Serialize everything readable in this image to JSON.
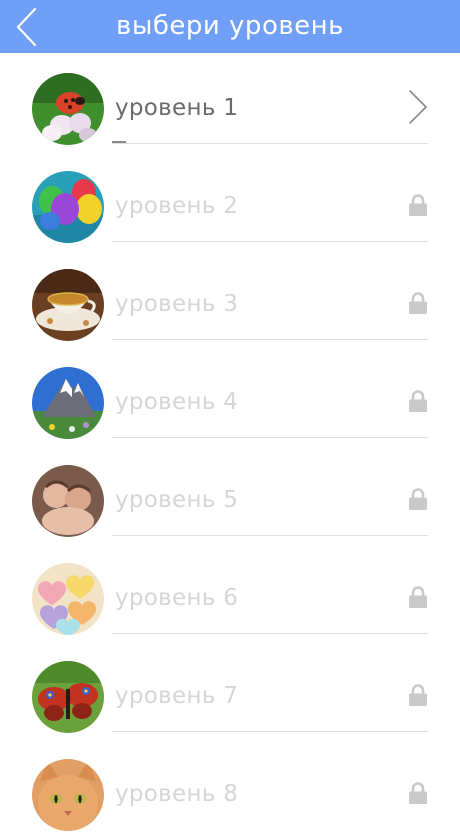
{
  "header": {
    "title": "выбери уровень",
    "background": "#6f9ff6"
  },
  "levels": [
    {
      "label": "уровень 1",
      "image": "ladybug-flower",
      "status": "unlocked"
    },
    {
      "label": "уровень 2",
      "image": "balloons",
      "status": "locked"
    },
    {
      "label": "уровень 3",
      "image": "tea-cup",
      "status": "locked"
    },
    {
      "label": "уровень 4",
      "image": "mountain",
      "status": "locked"
    },
    {
      "label": "уровень 5",
      "image": "babies",
      "status": "locked"
    },
    {
      "label": "уровень 6",
      "image": "candy-hearts",
      "status": "locked"
    },
    {
      "label": "уровень 7",
      "image": "butterfly",
      "status": "locked"
    },
    {
      "label": "уровень 8",
      "image": "cat",
      "status": "locked"
    }
  ],
  "icons": {
    "back": "chevron-left-icon",
    "open": "chevron-right-icon",
    "locked": "lock-icon"
  }
}
